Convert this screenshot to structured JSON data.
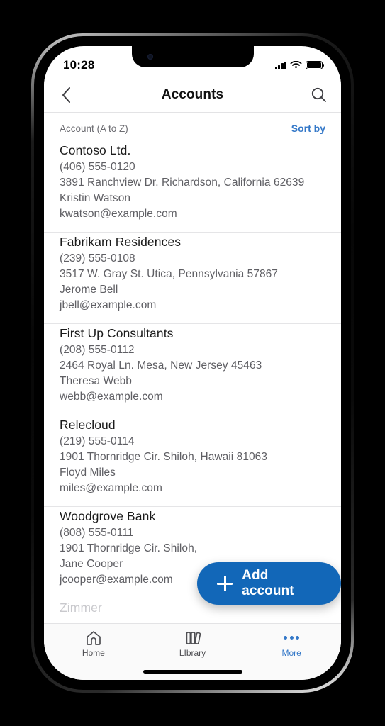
{
  "status_bar": {
    "time": "10:28",
    "signal_icon": "cellular-bars-icon",
    "wifi_icon": "wifi-icon",
    "battery_icon": "battery-full-icon"
  },
  "nav_bar": {
    "back_icon": "chevron-left-icon",
    "title": "Accounts",
    "search_icon": "search-icon"
  },
  "sort_bar": {
    "label": "Account (A to Z)",
    "action": "Sort by",
    "action_color": "#3478c8"
  },
  "accounts": [
    {
      "name": "Contoso Ltd.",
      "phone": "(406) 555-0120",
      "address": "3891 Ranchview Dr. Richardson, California 62639",
      "contact": "Kristin Watson",
      "email": "kwatson@example.com"
    },
    {
      "name": "Fabrikam Residences",
      "phone": "(239) 555-0108",
      "address": "3517 W. Gray St. Utica, Pennsylvania 57867",
      "contact": "Jerome Bell",
      "email": "jbell@example.com"
    },
    {
      "name": "First Up Consultants",
      "phone": "(208) 555-0112",
      "address": "2464 Royal Ln. Mesa, New Jersey 45463",
      "contact": "Theresa Webb",
      "email": "webb@example.com"
    },
    {
      "name": "Relecloud",
      "phone": "(219) 555-0114",
      "address": "1901 Thornridge Cir. Shiloh, Hawaii 81063",
      "contact": "Floyd Miles",
      "email": "miles@example.com"
    },
    {
      "name": "Woodgrove Bank",
      "phone": "(808) 555-0111",
      "address": "1901 Thornridge Cir. Shiloh,",
      "contact": "Jane Cooper",
      "email": "jcooper@example.com"
    },
    {
      "name": "Zimmer",
      "phone": "",
      "address": "",
      "contact": "",
      "email": ""
    }
  ],
  "fab": {
    "label": "Add account",
    "icon": "plus-icon",
    "color": "#1267b8"
  },
  "tab_bar": {
    "tabs": [
      {
        "label": "Home",
        "icon": "home-icon",
        "active": false
      },
      {
        "label": "LIbrary",
        "icon": "books-icon",
        "active": false
      },
      {
        "label": "More",
        "icon": "ellipsis-icon",
        "active": true
      }
    ],
    "active_color": "#3478c8"
  }
}
